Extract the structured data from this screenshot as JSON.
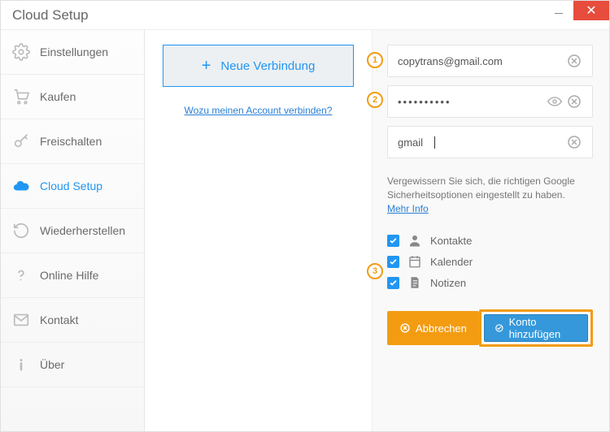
{
  "window": {
    "title": "Cloud Setup"
  },
  "sidebar": {
    "items": [
      {
        "label": "Einstellungen"
      },
      {
        "label": "Kaufen"
      },
      {
        "label": "Freischalten"
      },
      {
        "label": "Cloud Setup"
      },
      {
        "label": "Wiederherstellen"
      },
      {
        "label": "Online Hilfe"
      },
      {
        "label": "Kontakt"
      },
      {
        "label": "Über"
      }
    ]
  },
  "middle": {
    "new_connection": "Neue Verbindung",
    "why_link": "Wozu meinen Account verbinden?"
  },
  "form": {
    "email": {
      "value": "copytrans@gmail.com"
    },
    "password": {
      "masked": "••••••••••"
    },
    "name": {
      "value": "gmail"
    },
    "hint_text": "Vergewissern Sie sich, die richtigen Google Sicherheitsoptionen eingestellt zu haben.",
    "hint_link": "Mehr Info",
    "checks": [
      {
        "label": "Kontakte",
        "checked": true
      },
      {
        "label": "Kalender",
        "checked": true
      },
      {
        "label": "Notizen",
        "checked": true
      }
    ],
    "cancel": "Abbrechen",
    "add": "Konto hinzufügen"
  },
  "callouts": {
    "c1": "1",
    "c2": "2",
    "c3": "3"
  }
}
